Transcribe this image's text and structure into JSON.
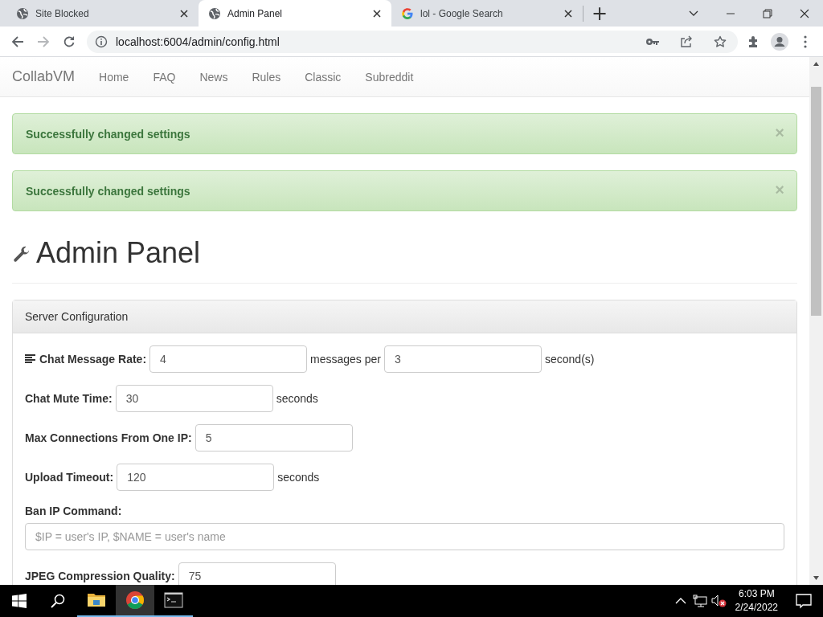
{
  "browser": {
    "tabs": [
      {
        "title": "Site Blocked",
        "kind": "globe",
        "selected": false
      },
      {
        "title": "Admin Panel",
        "kind": "globe",
        "selected": true
      },
      {
        "title": "lol - Google Search",
        "kind": "google",
        "selected": false
      }
    ],
    "new_tab": "+",
    "url": "localhost:6004/admin/config.html"
  },
  "navbar": {
    "brand": "CollabVM",
    "links": [
      "Home",
      "FAQ",
      "News",
      "Rules",
      "Classic",
      "Subreddit"
    ]
  },
  "alerts": [
    {
      "text": "Successfully changed settings",
      "close": "×"
    },
    {
      "text": "Successfully changed settings",
      "close": "×"
    }
  ],
  "page_title": "Admin Panel",
  "panel": {
    "title": "Server Configuration",
    "rows": [
      {
        "kind": "inline-icon",
        "label": "Chat Message Rate:",
        "parts": [
          {
            "kind": "input",
            "value": "4"
          },
          {
            "kind": "text",
            "text": "messages per"
          },
          {
            "kind": "input",
            "value": "3"
          },
          {
            "kind": "text",
            "text": "second(s)"
          }
        ]
      },
      {
        "kind": "inline",
        "label": "Chat Mute Time:",
        "parts": [
          {
            "kind": "input",
            "value": "30"
          },
          {
            "kind": "text",
            "text": "seconds"
          }
        ]
      },
      {
        "kind": "inline",
        "label": "Max Connections From One IP:",
        "parts": [
          {
            "kind": "input",
            "value": "5"
          }
        ]
      },
      {
        "kind": "inline",
        "label": "Upload Timeout:",
        "parts": [
          {
            "kind": "input",
            "value": "120"
          },
          {
            "kind": "text",
            "text": "seconds"
          }
        ]
      },
      {
        "kind": "stacked",
        "label": "Ban IP Command:",
        "parts": [
          {
            "kind": "input",
            "placeholder": "$IP = user's IP, $NAME = user's name"
          }
        ]
      },
      {
        "kind": "inline",
        "label": "JPEG Compression Quality:",
        "parts": [
          {
            "kind": "input",
            "value": "75"
          }
        ]
      }
    ]
  },
  "taskbar": {
    "apps": [
      {
        "kind": "folder",
        "selected": false
      },
      {
        "kind": "chrome",
        "selected": true
      },
      {
        "kind": "terminal",
        "selected": false
      }
    ],
    "time": "6:03 PM",
    "date": "2/24/2022"
  }
}
